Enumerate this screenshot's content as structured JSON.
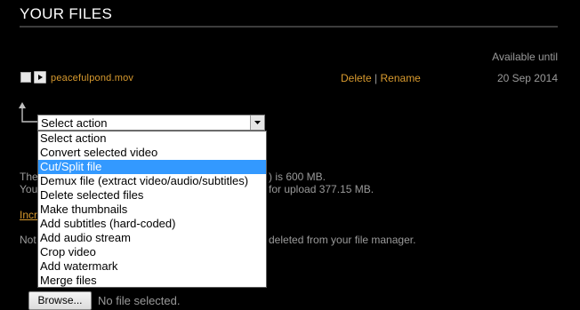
{
  "header": {
    "title": "YOUR FILES"
  },
  "table": {
    "available_until_label": "Available until",
    "files": [
      {
        "name": "peacefulpond.mov",
        "delete_label": "Delete",
        "separator": "|",
        "rename_label": "Rename",
        "available_until": "20 Sep 2014"
      }
    ]
  },
  "action_select": {
    "current": "Select action",
    "options": [
      "Select action",
      "Convert selected video",
      "Cut/Split file",
      "Demux file (extract video/audio/subtitles)",
      "Delete selected files",
      "Make thumbnails",
      "Add subtitles (hard-coded)",
      "Add audio stream",
      "Crop video",
      "Add watermark",
      "Merge files"
    ],
    "highlighted_index": 2
  },
  "background_text": {
    "line1_prefix": "The",
    "line1_suffix": ") is 600 MB.",
    "line2_prefix": "You",
    "line2_suffix": "for upload 377.15 MB.",
    "link_fragment": "Incr",
    "note_prefix": "Not",
    "note_suffix": "deleted from your file manager."
  },
  "upload": {
    "browse_label": "Browse...",
    "status": "No file selected."
  },
  "colors": {
    "accent": "#d89a2e",
    "highlight": "#3399ff"
  }
}
